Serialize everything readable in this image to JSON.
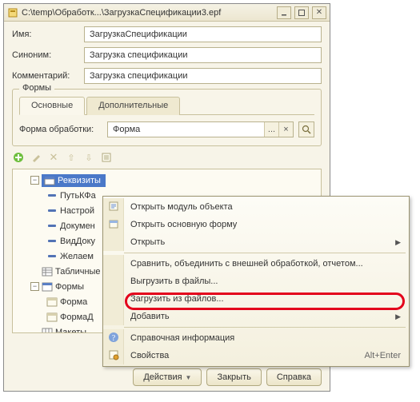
{
  "window": {
    "title": "C:\\temp\\Обработк...\\ЗагрузкаСпецификации3.epf",
    "icons": {
      "app": "doc-icon",
      "min": "minimize-icon",
      "max": "maximize-icon",
      "close": "close-icon"
    }
  },
  "fields": {
    "name_label": "Имя:",
    "name_value": "ЗагрузкаСпецификации",
    "synonym_label": "Синоним:",
    "synonym_value": "Загрузка спецификации",
    "comment_label": "Комментарий:",
    "comment_value": "Загрузка спецификации"
  },
  "forms_group": {
    "legend": "Формы",
    "tabs": [
      "Основные",
      "Дополнительные"
    ],
    "form_proc_label": "Форма обработки:",
    "form_proc_value": "Форма",
    "clear_btn": "×",
    "dots_btn": "..."
  },
  "toolbar2": {
    "add": "add-icon",
    "edit": "edit-icon",
    "delete": "delete-icon",
    "up": "up-icon",
    "down": "down-icon",
    "list": "list-icon"
  },
  "tree": {
    "items": [
      {
        "level": 0,
        "exp": "−",
        "icon": "requisites",
        "label": "Реквизиты",
        "selected": true
      },
      {
        "level": 1,
        "icon": "attr",
        "label": "ПутьКФа"
      },
      {
        "level": 1,
        "icon": "attr",
        "label": "Настрой"
      },
      {
        "level": 1,
        "icon": "attr",
        "label": "Докумен"
      },
      {
        "level": 1,
        "icon": "attr",
        "label": "ВидДоку"
      },
      {
        "level": 1,
        "icon": "attr",
        "label": "Желаем"
      },
      {
        "level": 0,
        "icon": "tables",
        "label": "Табличные ч"
      },
      {
        "level": 0,
        "exp": "−",
        "icon": "forms",
        "label": "Формы"
      },
      {
        "level": 1,
        "icon": "form",
        "label": "Форма"
      },
      {
        "level": 1,
        "icon": "form",
        "label": "ФормаД"
      },
      {
        "level": 0,
        "icon": "layouts",
        "label": "Макеты"
      }
    ]
  },
  "buttons": {
    "actions": "Действия",
    "close": "Закрыть",
    "help": "Справка"
  },
  "context_menu": {
    "items": [
      {
        "type": "item",
        "icon": "module",
        "label": "Открыть модуль объекта"
      },
      {
        "type": "item",
        "icon": "form-open",
        "label": "Открыть основную форму"
      },
      {
        "type": "item",
        "label": "Открыть",
        "submenu": true
      },
      {
        "type": "sep"
      },
      {
        "type": "item",
        "label": "Сравнить, объединить с внешней обработкой, отчетом..."
      },
      {
        "type": "item",
        "label": "Выгрузить в файлы...",
        "highlight": true
      },
      {
        "type": "item",
        "label": "Загрузить из файлов..."
      },
      {
        "type": "item",
        "label": "Добавить",
        "submenu": true
      },
      {
        "type": "sep"
      },
      {
        "type": "item",
        "icon": "help",
        "label": "Справочная информация"
      },
      {
        "type": "item",
        "icon": "props",
        "label": "Свойства",
        "shortcut": "Alt+Enter"
      }
    ]
  }
}
